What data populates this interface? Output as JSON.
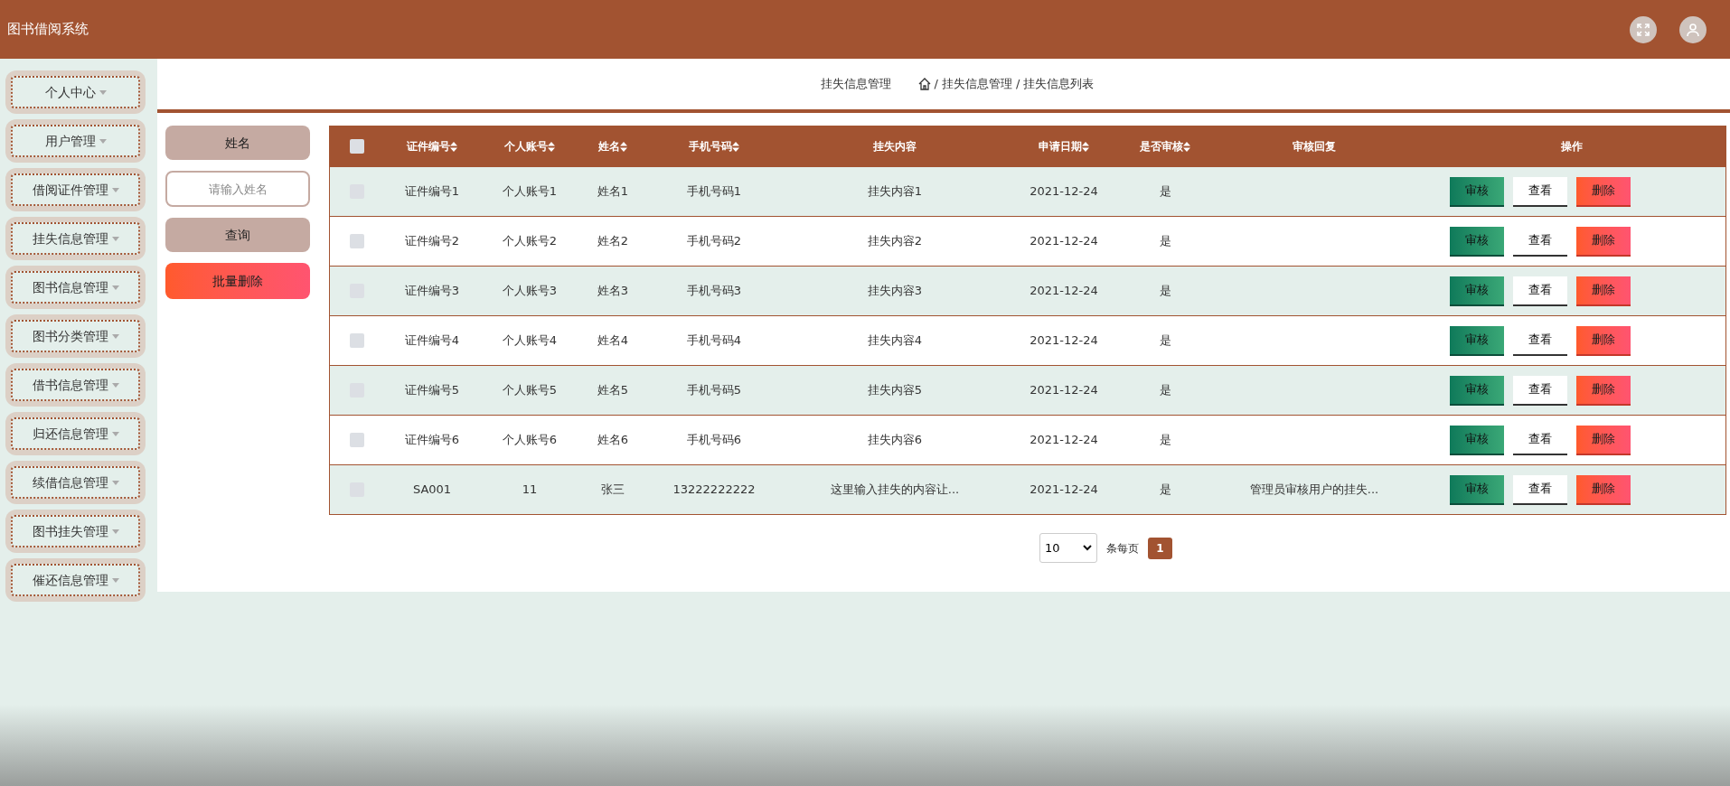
{
  "header": {
    "title": "图书借阅系统"
  },
  "sidebar": {
    "items": [
      {
        "label": "个人中心"
      },
      {
        "label": "用户管理"
      },
      {
        "label": "借阅证件管理"
      },
      {
        "label": "挂失信息管理"
      },
      {
        "label": "图书信息管理"
      },
      {
        "label": "图书分类管理"
      },
      {
        "label": "借书信息管理"
      },
      {
        "label": "归还信息管理"
      },
      {
        "label": "续借信息管理"
      },
      {
        "label": "图书挂失管理"
      },
      {
        "label": "催还信息管理"
      }
    ]
  },
  "breadcrumb": {
    "title": "挂失信息管理",
    "separator": "/",
    "path": [
      "挂失信息管理",
      "挂失信息列表"
    ]
  },
  "filter": {
    "label": "姓名",
    "placeholder": "请输入姓名",
    "search_button": "查询",
    "batch_delete_button": "批量删除"
  },
  "table": {
    "select_all_checked": false,
    "columns": [
      {
        "label": "证件编号",
        "sortable": true
      },
      {
        "label": "个人账号",
        "sortable": true
      },
      {
        "label": "姓名",
        "sortable": true
      },
      {
        "label": "手机号码",
        "sortable": true
      },
      {
        "label": "挂失内容",
        "sortable": false
      },
      {
        "label": "申请日期",
        "sortable": true
      },
      {
        "label": "是否审核",
        "sortable": true
      },
      {
        "label": "审核回复",
        "sortable": false
      },
      {
        "label": "操作",
        "sortable": false
      }
    ],
    "rows": [
      {
        "checked": false,
        "cells": [
          "证件编号1",
          "个人账号1",
          "姓名1",
          "手机号码1",
          "挂失内容1",
          "2021-12-24",
          "是"
        ],
        "actions": [
          "审核",
          "查看",
          "删除"
        ]
      },
      {
        "checked": false,
        "cells": [
          "证件编号2",
          "个人账号2",
          "姓名2",
          "手机号码2",
          "挂失内容2",
          "2021-12-24",
          "是"
        ],
        "actions": [
          "审核",
          "查看",
          "删除"
        ]
      },
      {
        "checked": false,
        "cells": [
          "证件编号3",
          "个人账号3",
          "姓名3",
          "手机号码3",
          "挂失内容3",
          "2021-12-24",
          "是"
        ],
        "actions": [
          "审核",
          "查看",
          "删除"
        ]
      },
      {
        "checked": false,
        "cells": [
          "证件编号4",
          "个人账号4",
          "姓名4",
          "手机号码4",
          "挂失内容4",
          "2021-12-24",
          "是"
        ],
        "actions": [
          "审核",
          "查看",
          "删除"
        ]
      },
      {
        "checked": false,
        "cells": [
          "证件编号5",
          "个人账号5",
          "姓名5",
          "手机号码5",
          "挂失内容5",
          "2021-12-24",
          "是"
        ],
        "actions": [
          "审核",
          "查看",
          "删除"
        ]
      },
      {
        "checked": false,
        "cells": [
          "证件编号6",
          "个人账号6",
          "姓名6",
          "手机号码6",
          "挂失内容6",
          "2021-12-24",
          "是"
        ],
        "actions": [
          "审核",
          "查看",
          "删除"
        ]
      },
      {
        "checked": false,
        "cells": [
          "SA001",
          "11",
          "张三",
          "13222222222",
          "这里输入挂失的内容让...",
          "2021-12-24",
          "是",
          "管理员审核用户的挂失..."
        ],
        "actions": [
          "审核",
          "查看",
          "删除"
        ]
      }
    ]
  },
  "pagination": {
    "page_size": "10",
    "page_size_label": "条每页",
    "pages": [
      {
        "label": "1",
        "selected": true
      }
    ]
  }
}
